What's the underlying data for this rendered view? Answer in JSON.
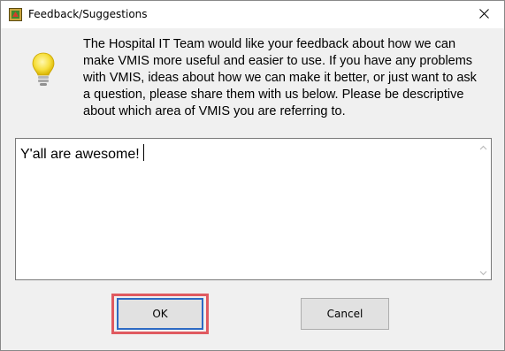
{
  "window": {
    "title": "Feedback/Suggestions"
  },
  "icons": {
    "app": "app-icon",
    "close": "close-icon",
    "bulb": "lightbulb-icon",
    "scroll_up": "scroll-up-arrow-icon",
    "scroll_down": "scroll-down-arrow-icon"
  },
  "message": "The Hospital IT Team would like your feedback about how we can\nmake VMIS more useful and easier to use.  If you have any problems\nwith VMIS, ideas about how we can make it better, or just want to ask\na question, please share them with us below.  Please be descriptive\nabout which area of VMIS you are referring to.",
  "feedback_input": {
    "value": "Y'all are awesome!"
  },
  "buttons": {
    "ok_label": "OK",
    "cancel_label": "Cancel"
  },
  "colors": {
    "highlight": "#e05a60",
    "focus_border": "#2d6ac4",
    "button_face": "#e1e1e1",
    "dialog_bg": "#f0f0f0"
  }
}
